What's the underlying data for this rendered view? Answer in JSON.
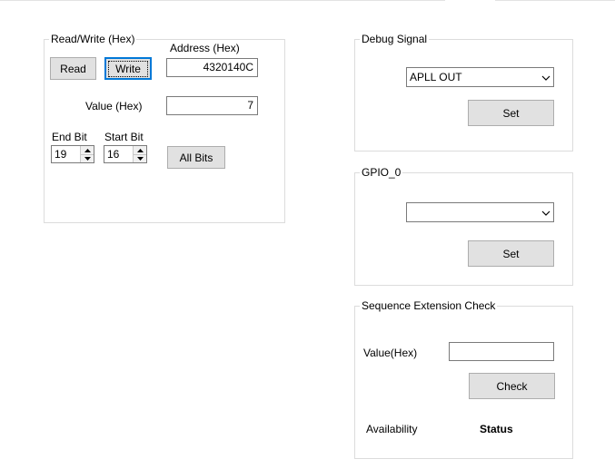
{
  "read_write": {
    "title": "Read/Write (Hex)",
    "read_label": "Read",
    "write_label": "Write",
    "address_label": "Address (Hex)",
    "address_value": "4320140C",
    "value_label": "Value (Hex)",
    "value_value": "7",
    "end_bit_label": "End Bit",
    "end_bit_value": "19",
    "start_bit_label": "Start Bit",
    "start_bit_value": "16",
    "all_bits_label": "All Bits"
  },
  "debug_signal": {
    "title": "Debug Signal",
    "selected": "APLL OUT",
    "set_label": "Set"
  },
  "gpio": {
    "title": "GPIO_0",
    "selected": "",
    "set_label": "Set"
  },
  "sequence": {
    "title": "Sequence Extension Check",
    "value_label": "Value(Hex)",
    "value_value": "",
    "check_label": "Check",
    "availability_label": "Availability",
    "status_label": "Status"
  },
  "icons": {
    "spin_up": "spin-up-arrow-icon",
    "spin_down": "spin-down-arrow-icon",
    "dropdown": "chevron-down-icon"
  }
}
